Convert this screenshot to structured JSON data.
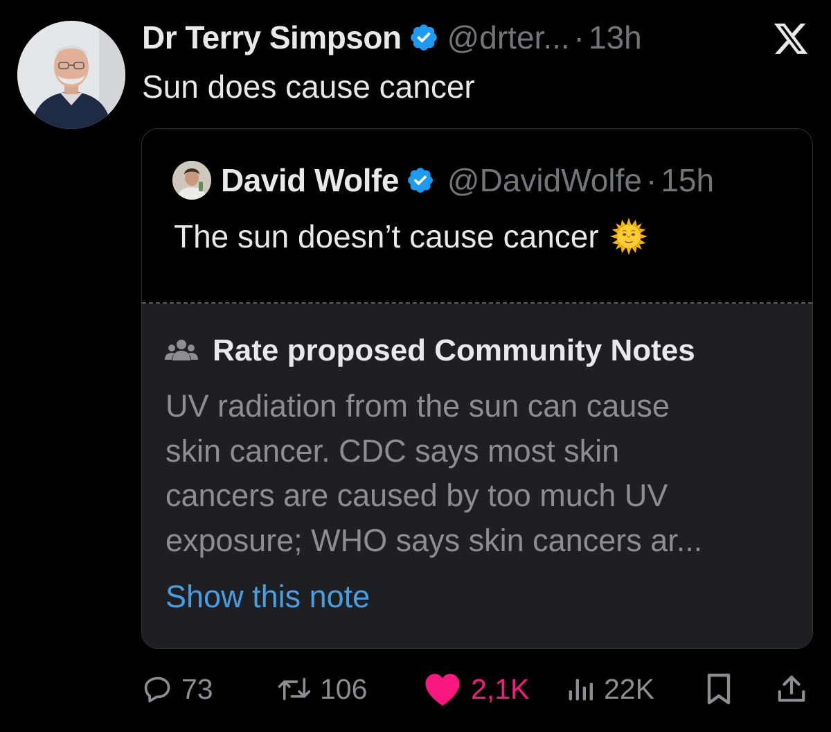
{
  "tweet": {
    "author_name": "Dr Terry Simpson",
    "handle": "@drter...",
    "separator": "·",
    "time": "13h",
    "text": "Sun does cause cancer"
  },
  "quoted_tweet": {
    "author_name": "David Wolfe",
    "handle": "@DavidWolfe",
    "separator": "·",
    "time": "15h",
    "text": "The sun doesn’t cause cancer",
    "emoji": "sun-with-face"
  },
  "community_notes": {
    "header": "Rate proposed Community Notes",
    "note_lines": [
      "UV radiation from the sun can cause",
      "skin cancer. CDC says most skin",
      "cancers are caused by too much UV",
      "exposure; WHO says skin cancers ar..."
    ],
    "show_label": "Show this note"
  },
  "actions": {
    "replies": "73",
    "reposts": "106",
    "likes": "2,1K",
    "views": "22K"
  },
  "icons": {
    "close": "x-logo-icon",
    "verified": "verified-badge-icon",
    "community": "people-icon",
    "reply": "reply-icon",
    "repost": "repost-icon",
    "like": "heart-icon",
    "views": "views-icon",
    "bookmark": "bookmark-icon",
    "share": "share-icon"
  },
  "colors": {
    "background": "#000000",
    "verified_blue": "#1d9bf0",
    "link_blue": "#4a9ee0",
    "like_pink": "#f91880",
    "muted_text": "#71767b",
    "note_background": "#1d1f23"
  }
}
